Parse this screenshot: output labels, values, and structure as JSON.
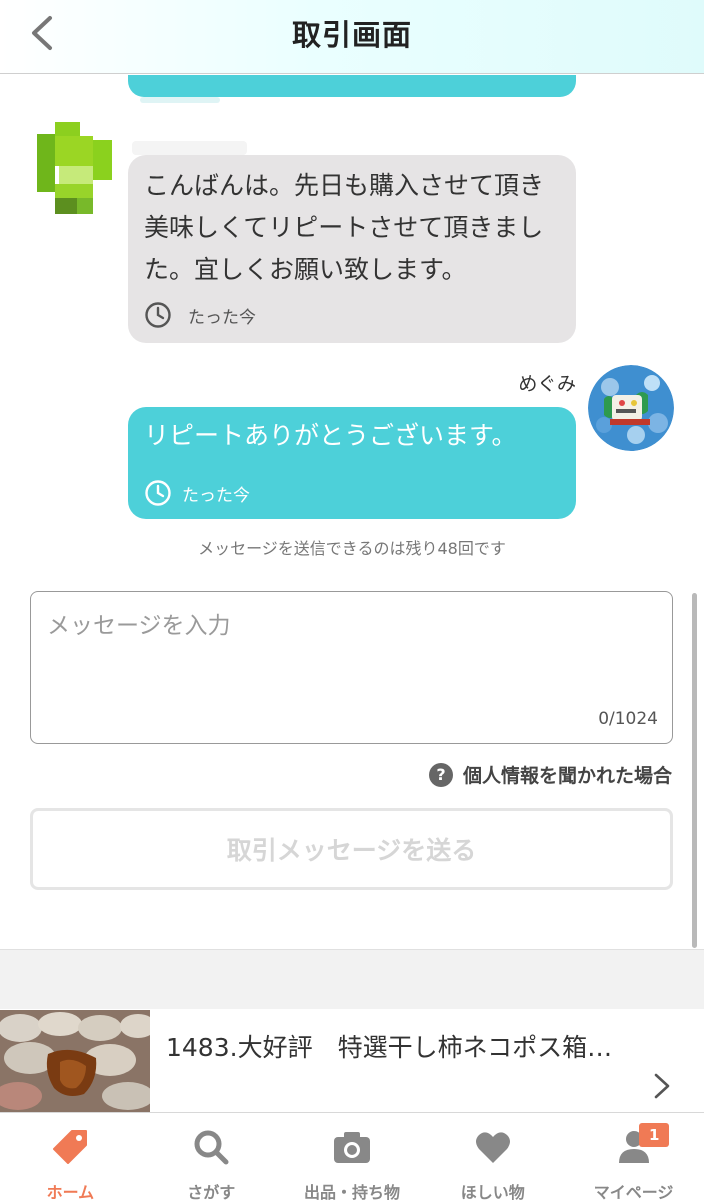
{
  "header": {
    "title": "取引画面"
  },
  "messages": [
    {
      "text": "こんばんは。先日も購入させて頂き美味しくてリピートさせて頂きました。宜しくお願い致します。",
      "time": "たった今"
    },
    {
      "sender": "めぐみ",
      "text": "リピートありがとうございます。",
      "time": "たった今"
    }
  ],
  "compose": {
    "remaining_notice": "メッセージを送信できるのは残り48回です",
    "placeholder": "メッセージを入力",
    "char_count": "0/1024",
    "personal_info_link": "個人情報を聞かれた場合",
    "help_icon_glyph": "?",
    "send_label": "取引メッセージを送る"
  },
  "product": {
    "title": "1483.大好評　特選干し柿ネコポス箱…"
  },
  "tabbar": {
    "items": [
      {
        "label": "ホーム",
        "icon": "tag-icon",
        "active": true
      },
      {
        "label": "さがす",
        "icon": "search-icon"
      },
      {
        "label": "出品・持ち物",
        "icon": "camera-icon"
      },
      {
        "label": "ほしい物",
        "icon": "heart-icon"
      },
      {
        "label": "マイページ",
        "icon": "person-icon"
      }
    ],
    "mypage_badge": "1"
  },
  "colors": {
    "accent_teal": "#4dd0d9",
    "incoming_bubble": "#e6e4e5",
    "active_tab": "#f07a55",
    "inactive_tab": "#888888"
  }
}
